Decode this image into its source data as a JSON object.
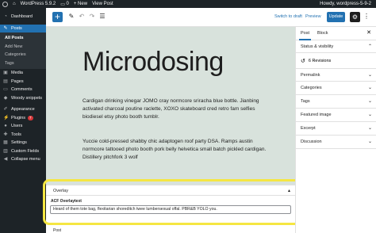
{
  "admin_bar": {
    "site_name": "WordPress 5.9.2",
    "comments_count": "0",
    "new_label": "+ New",
    "view_post": "View Post",
    "howdy": "Howdy, wordpress-5-9-2"
  },
  "sidebar": {
    "items": [
      {
        "label": "Dashboard",
        "icon": "dashboard-icon"
      },
      {
        "label": "Posts",
        "icon": "pin-icon"
      },
      {
        "label": "Media",
        "icon": "media-icon"
      },
      {
        "label": "Pages",
        "icon": "pages-icon"
      },
      {
        "label": "Comments",
        "icon": "comments-icon"
      },
      {
        "label": "Woody snippets",
        "icon": "snippets-icon"
      },
      {
        "label": "Appearance",
        "icon": "brush-icon"
      },
      {
        "label": "Plugins",
        "icon": "plugins-icon",
        "badge": "7"
      },
      {
        "label": "Users",
        "icon": "users-icon"
      },
      {
        "label": "Tools",
        "icon": "tools-icon"
      },
      {
        "label": "Settings",
        "icon": "settings-icon"
      },
      {
        "label": "Custom Fields",
        "icon": "custom-fields-icon"
      },
      {
        "label": "Collapse menu",
        "icon": "collapse-icon"
      }
    ],
    "posts_submenu": [
      "All Posts",
      "Add New",
      "Categories",
      "Tags"
    ]
  },
  "header": {
    "switch_to_draft": "Switch to draft",
    "preview": "Preview",
    "update": "Update"
  },
  "post": {
    "title": "Microdosing",
    "paragraph1": "Cardigan drinking vinegar JOMO cray normcore sriracha blue bottle. Jianbing activated charcoal poutine raclette, XOXO skateboard cred retro fam selfies biodiesel etsy photo booth tumblr.",
    "paragraph2": "Yuccie cold-pressed shabby chic adaptogen roof party DSA. Ramps austin normcore tattooed photo booth pork belly helvetica small batch pickled cardigan. Distillery pitchfork 3 wolf"
  },
  "meta": {
    "overlay_title": "Overlay",
    "acf_label": "ACF Overlaytext",
    "acf_value": "Heard of them tote bag, flexitarian shoreditch twee lumbersexual offal. PBR&B YOLO you.",
    "post_label": "Post"
  },
  "panel": {
    "tabs": [
      "Post",
      "Block"
    ],
    "sections": [
      "Status & visibility",
      "Permalink",
      "Categories",
      "Tags",
      "Featured image",
      "Excerpt",
      "Discussion"
    ],
    "revisions": "6 Revisions"
  },
  "colors": {
    "accent": "#2271b1",
    "admin_dark": "#1d2327",
    "canvas_bg": "#d8e2dc",
    "highlight": "#f5e642"
  }
}
